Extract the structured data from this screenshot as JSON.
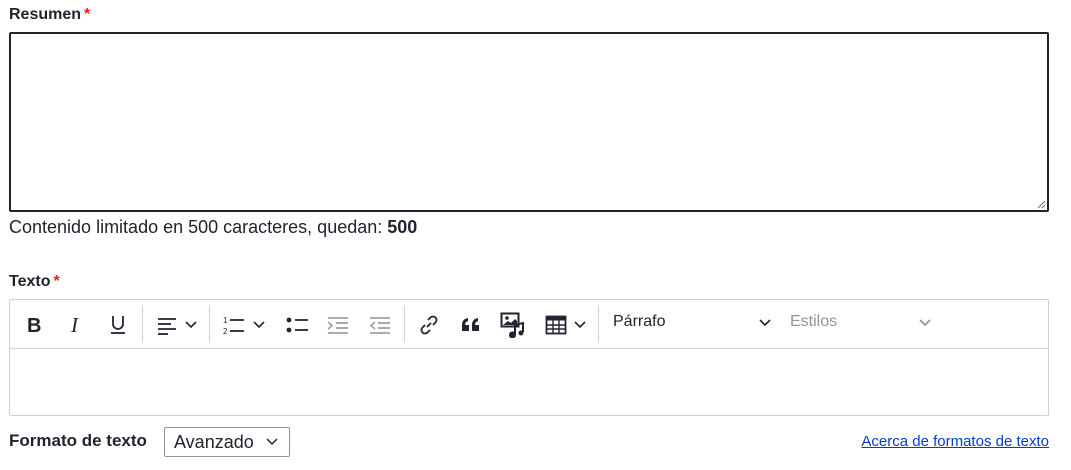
{
  "summary": {
    "label": "Resumen",
    "required_mark": "*",
    "value": "",
    "counter_text": "Contenido limitado en 500 caracteres, quedan: ",
    "counter_value": "500"
  },
  "text": {
    "label": "Texto",
    "required_mark": "*",
    "toolbar": {
      "icons": [
        "bold-icon",
        "italic-icon",
        "underline-icon",
        "align-left-icon",
        "numbered-list-icon",
        "bulleted-list-icon",
        "indent-icon",
        "outdent-icon",
        "link-icon",
        "blockquote-icon",
        "media-icon",
        "table-icon"
      ],
      "heading_value": "Párrafo",
      "styles_placeholder": "Estilos"
    },
    "content": ""
  },
  "format": {
    "label": "Formato de texto",
    "selected": "Avanzado",
    "about_link": "Acerca de formatos de texto"
  },
  "colors": {
    "required": "#dc2323",
    "link": "#003ecc",
    "text": "#222330",
    "disabled_icon": "#8e929c"
  }
}
